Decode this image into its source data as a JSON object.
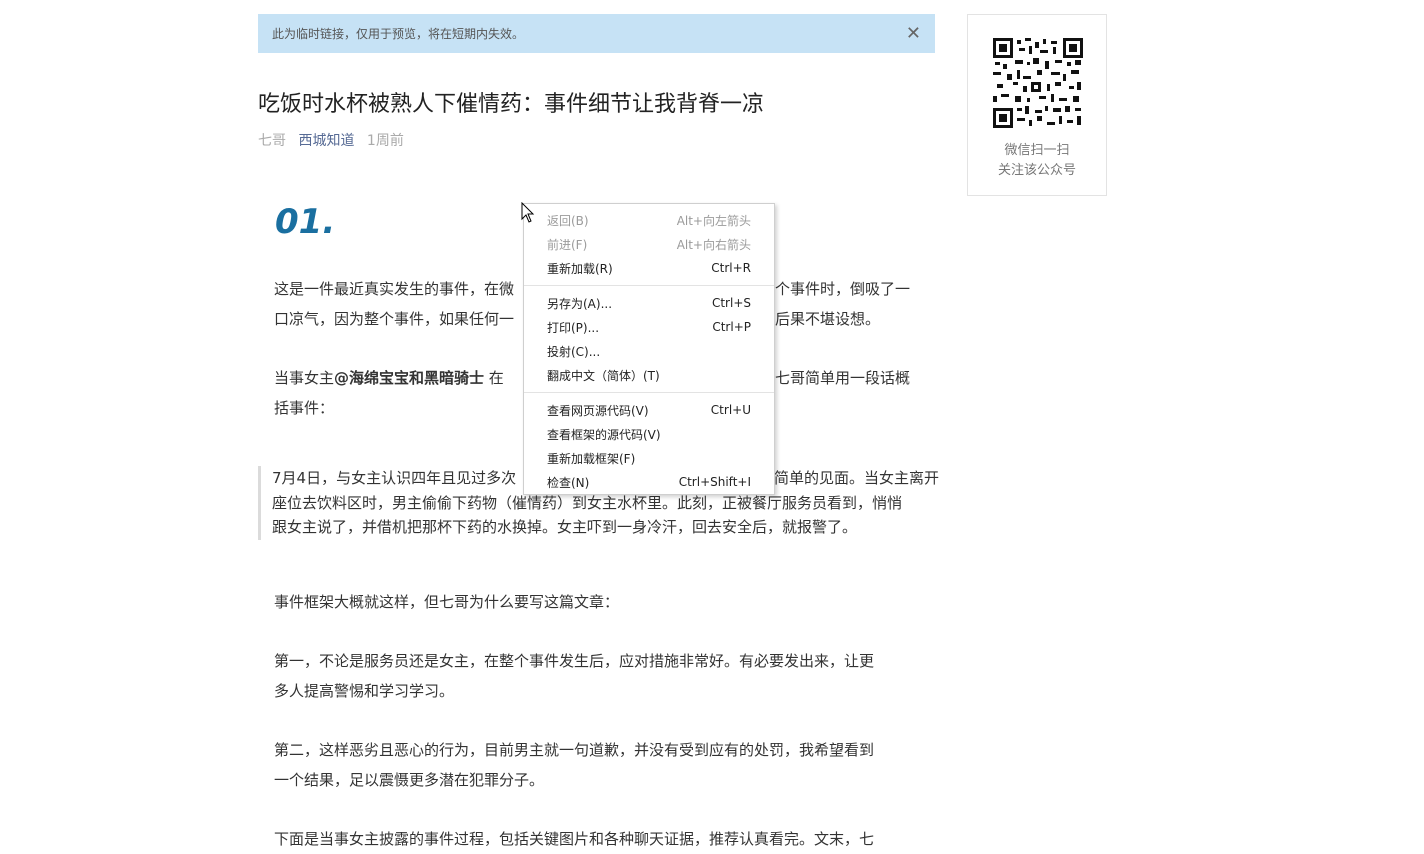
{
  "notice": {
    "text": "此为临时链接，仅用于预览，将在短期内失效。",
    "close_symbol": "✕"
  },
  "article": {
    "title": "吃饭时水杯被熟人下催情药：事件细节让我背脊一凉",
    "author": "七哥",
    "account": "西城知道",
    "time": "1周前",
    "section_number": "01.",
    "p1_line1": "这是一件最近真实发生的事件，在微",
    "p1_line1_end": "个事件时，倒吸了一",
    "p1_line2": "口凉气，因为整个事件，如果任何一",
    "p1_line2_end": "后果不堪设想。",
    "p2_line1_start": "当事女主",
    "p2_line1_bold": "@海绵宝宝和黑暗骑士",
    "p2_line1_mid": " 在",
    "p2_line1_end": "七哥简单用一段话概",
    "p2_line2": "括事件：",
    "quote_line1_start": "7月4日，与女主认识四年且见过多次",
    "quote_line1_end": "简单的见面。当女主离开",
    "quote_line2": "座位去饮料区时，男主偷偷下药物（催情药）到女主水杯里。此刻，正被餐厅服务员看到，悄悄",
    "quote_line3": "跟女主说了，并借机把那杯下药的水换掉。女主吓到一身冷汗，回去安全后，就报警了。",
    "p3": "事件框架大概就这样，但七哥为什么要写这篇文章：",
    "p4_line1": "第一，不论是服务员还是女主，在整个事件发生后，应对措施非常好。有必要发出来，让更",
    "p4_line2": "多人提高警惕和学习学习。",
    "p5_line1": "第二，这样恶劣且恶心的行为，目前男主就一句道歉，并没有受到应有的处罚，我希望看到",
    "p5_line2": "一个结果，足以震慑更多潜在犯罪分子。",
    "p6_partial": "下面是当事女主披露的事件过程，包括关键图片和各种聊天证据，推荐认真看完。文末，七"
  },
  "qr": {
    "line1": "微信扫一扫",
    "line2": "关注该公众号"
  },
  "context_menu": {
    "back": {
      "label": "返回(B)",
      "shortcut": "Alt+向左箭头"
    },
    "forward": {
      "label": "前进(F)",
      "shortcut": "Alt+向右箭头"
    },
    "reload": {
      "label": "重新加载(R)",
      "shortcut": "Ctrl+R"
    },
    "save_as": {
      "label": "另存为(A)...",
      "shortcut": "Ctrl+S"
    },
    "print": {
      "label": "打印(P)...",
      "shortcut": "Ctrl+P"
    },
    "cast": {
      "label": "投射(C)..."
    },
    "translate": {
      "label": "翻成中文（简体）(T)"
    },
    "view_source": {
      "label": "查看网页源代码(V)",
      "shortcut": "Ctrl+U"
    },
    "view_frame_source": {
      "label": "查看框架的源代码(V)"
    },
    "reload_frame": {
      "label": "重新加载框架(F)"
    },
    "inspect": {
      "label": "检查(N)",
      "shortcut": "Ctrl+Shift+I"
    }
  }
}
